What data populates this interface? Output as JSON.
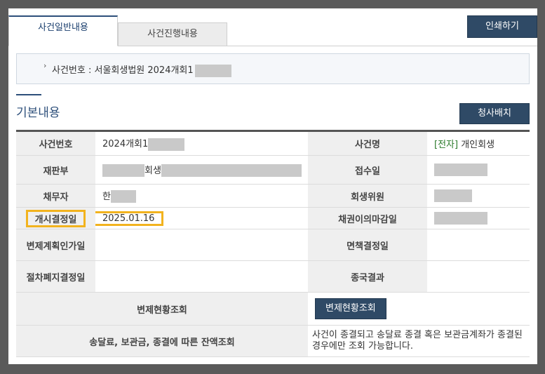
{
  "tabs": {
    "general": "사건일반내용",
    "progress": "사건진행내용"
  },
  "print_label": "인쇄하기",
  "case_header": {
    "label": "사건번호 : 서울회생법원 2024개회1"
  },
  "section_title": "기본내용",
  "assign_label": "청사배치",
  "rows": {
    "case_no_h": "사건번호",
    "case_no_v": "2024개회1",
    "case_name_h": "사건명",
    "case_name_tag": "[전자]",
    "case_name_v": "개인회생",
    "court_h": "재판부",
    "court_v": "회생",
    "received_h": "접수일",
    "debtor_h": "채무자",
    "debtor_v": "한",
    "trustee_h": "회생위원",
    "start_h": "개시결정일",
    "start_v": "2025.01.16",
    "claim_deadline_h": "채권이의마감일",
    "plan_approval_h": "변제계획인가일",
    "discharge_h": "면책결정일",
    "abolish_h": "절차폐지결정일",
    "final_result_h": "종국결과",
    "repay_h": "변제현황조회",
    "repay_btn": "변제현황조회",
    "balance_h": "송달료, 보관금, 종결에 따른 잔액조회",
    "balance_v": "사건이 종결되고 송달료 종결 혹은 보관금계좌가 종결된 경우에만 조회 가능합니다."
  },
  "colors": {
    "highlight": "#f2b31e",
    "button": "#2f4a66",
    "accent": "#2d4f7a"
  }
}
